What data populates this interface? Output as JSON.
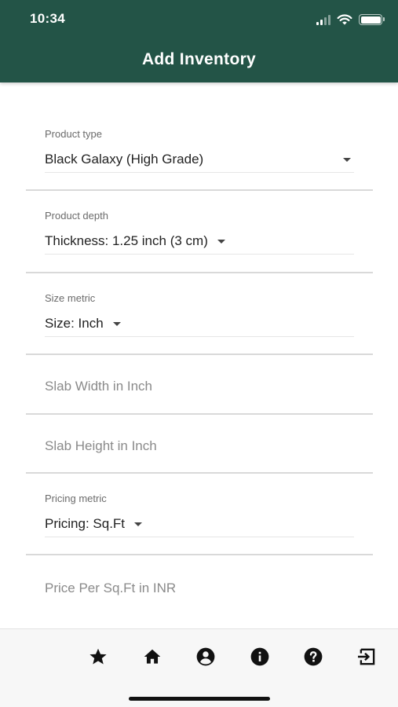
{
  "status_bar": {
    "time": "10:34"
  },
  "header": {
    "title": "Add Inventory",
    "background": "#235447"
  },
  "form": {
    "product_type": {
      "label": "Product type",
      "value": "Black Galaxy (High Grade)"
    },
    "product_depth": {
      "label": "Product depth",
      "value": "Thickness: 1.25 inch (3 cm)"
    },
    "size_metric": {
      "label": "Size metric",
      "value": "Size: Inch"
    },
    "slab_width": {
      "placeholder": "Slab Width in Inch",
      "value": ""
    },
    "slab_height": {
      "placeholder": "Slab Height in Inch",
      "value": ""
    },
    "pricing_metric": {
      "label": "Pricing metric",
      "value": "Pricing: Sq.Ft"
    },
    "price": {
      "placeholder": "Price Per Sq.Ft in INR",
      "value": ""
    }
  },
  "bottom_nav": {
    "icons": [
      "star-icon",
      "home-icon",
      "account-circle-icon",
      "info-icon",
      "help-icon",
      "logout-icon"
    ]
  }
}
